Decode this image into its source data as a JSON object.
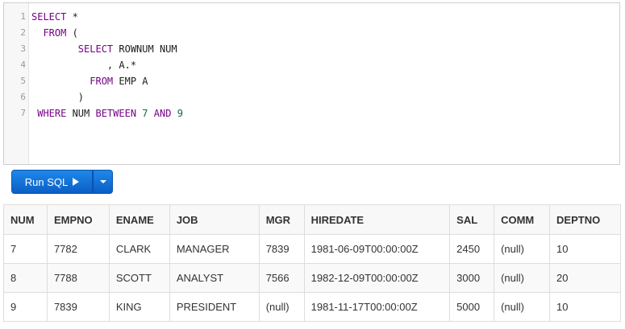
{
  "editor": {
    "lines": [
      {
        "num": "1",
        "parts": [
          {
            "t": "SELECT",
            "c": "kw"
          },
          {
            "t": " *",
            "c": ""
          }
        ]
      },
      {
        "num": "2",
        "parts": [
          {
            "t": "  ",
            "c": ""
          },
          {
            "t": "FROM",
            "c": "kw"
          },
          {
            "t": " (",
            "c": ""
          }
        ]
      },
      {
        "num": "3",
        "parts": [
          {
            "t": "        ",
            "c": ""
          },
          {
            "t": "SELECT",
            "c": "kw"
          },
          {
            "t": " ROWNUM NUM",
            "c": ""
          }
        ]
      },
      {
        "num": "4",
        "parts": [
          {
            "t": "             , A.*",
            "c": ""
          }
        ]
      },
      {
        "num": "5",
        "parts": [
          {
            "t": "          ",
            "c": ""
          },
          {
            "t": "FROM",
            "c": "kw"
          },
          {
            "t": " EMP A",
            "c": ""
          }
        ]
      },
      {
        "num": "6",
        "parts": [
          {
            "t": "        )",
            "c": ""
          }
        ]
      },
      {
        "num": "7",
        "parts": [
          {
            "t": " ",
            "c": ""
          },
          {
            "t": "WHERE",
            "c": "kw"
          },
          {
            "t": " NUM ",
            "c": ""
          },
          {
            "t": "BETWEEN",
            "c": "kw"
          },
          {
            "t": " ",
            "c": ""
          },
          {
            "t": "7",
            "c": "num"
          },
          {
            "t": " ",
            "c": ""
          },
          {
            "t": "AND",
            "c": "kw"
          },
          {
            "t": " ",
            "c": ""
          },
          {
            "t": "9",
            "c": "num"
          }
        ]
      }
    ]
  },
  "toolbar": {
    "run_label": "Run SQL",
    "run_icon": "play-icon",
    "menu_icon": "caret-down-icon",
    "accent_color": "#0b62c4"
  },
  "results": {
    "columns": [
      "NUM",
      "EMPNO",
      "ENAME",
      "JOB",
      "MGR",
      "HIREDATE",
      "SAL",
      "COMM",
      "DEPTNO"
    ],
    "rows": [
      [
        "7",
        "7782",
        "CLARK",
        "MANAGER",
        "7839",
        "1981-06-09T00:00:00Z",
        "2450",
        "(null)",
        "10"
      ],
      [
        "8",
        "7788",
        "SCOTT",
        "ANALYST",
        "7566",
        "1982-12-09T00:00:00Z",
        "3000",
        "(null)",
        "20"
      ],
      [
        "9",
        "7839",
        "KING",
        "PRESIDENT",
        "(null)",
        "1981-11-17T00:00:00Z",
        "5000",
        "(null)",
        "10"
      ]
    ]
  }
}
